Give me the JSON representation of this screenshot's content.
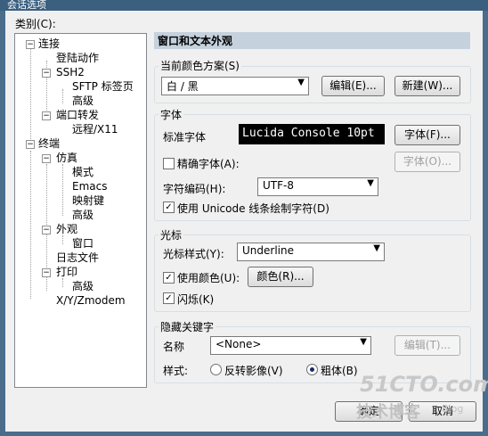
{
  "window": {
    "title": "会话选项"
  },
  "category": {
    "label": "类别(C):"
  },
  "tree": [
    {
      "label": "连接"
    },
    {
      "label": "登陆动作"
    },
    {
      "label": "SSH2"
    },
    {
      "label": "SFTP 标签页"
    },
    {
      "label": "高级"
    },
    {
      "label": "端口转发"
    },
    {
      "label": "远程/X11"
    },
    {
      "label": "终端"
    },
    {
      "label": "仿真"
    },
    {
      "label": "模式"
    },
    {
      "label": "Emacs"
    },
    {
      "label": "映射键"
    },
    {
      "label": "高级"
    },
    {
      "label": "外观"
    },
    {
      "label": "窗口"
    },
    {
      "label": "日志文件"
    },
    {
      "label": "打印"
    },
    {
      "label": "高级"
    },
    {
      "label": "X/Y/Zmodem"
    }
  ],
  "panel": {
    "title": "窗口和文本外观",
    "scheme": {
      "group": "当前颜色方案(S)",
      "value": "白 / 黑",
      "edit": "编辑(E)...",
      "new": "新建(W)..."
    },
    "font": {
      "group": "字体",
      "normal_label": "标准字体",
      "normal_preview": "Lucida Console 10pt",
      "font_btn": "字体(F)...",
      "precise_label": "精确字体(A):",
      "precise_btn": "字体(O)...",
      "encoding_label": "字符编码(H):",
      "encoding_value": "UTF-8",
      "unicode_label": "使用 Unicode 线条绘制字符(D)"
    },
    "cursor": {
      "group": "光标",
      "style_label": "光标样式(Y):",
      "style_value": "Underline",
      "use_color_label": "使用颜色(U):",
      "color_btn": "颜色(R)...",
      "blink_label": "闪烁(K)"
    },
    "keyword": {
      "group": "隐藏关键字",
      "name_label": "名称",
      "name_value": "<None>",
      "edit_btn": "编辑(T)...",
      "style_label": "样式:",
      "reverse_label": "反转影像(V)",
      "bold_label": "粗体(B)"
    }
  },
  "footer": {
    "ok": "确定",
    "cancel": "取消"
  },
  "watermark": {
    "line1": "51CTO.com",
    "line2": "技术博客",
    "line3": "Blog"
  }
}
